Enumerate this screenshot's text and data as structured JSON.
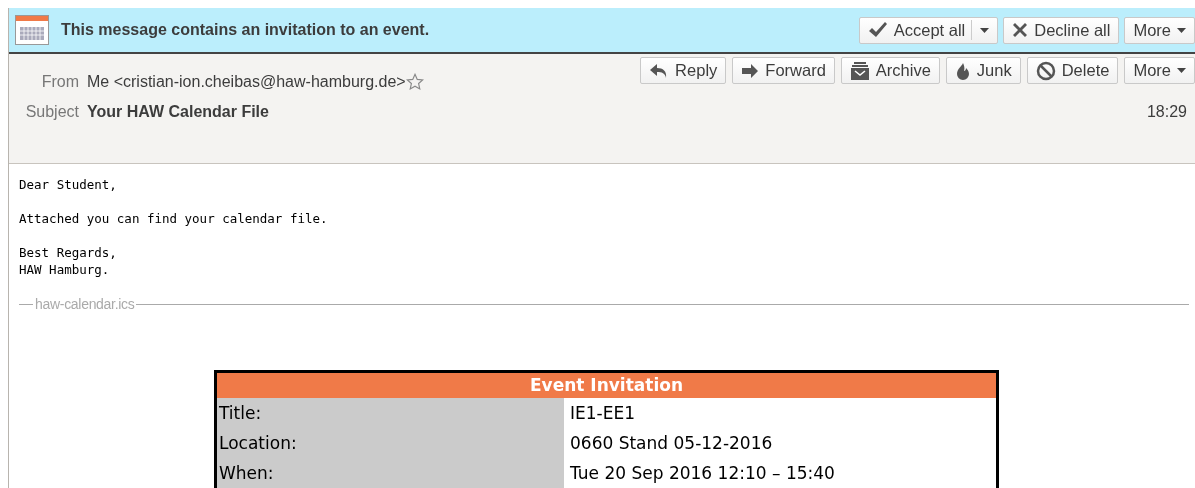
{
  "invitation_bar": {
    "message": "This message contains an invitation to an event.",
    "buttons": [
      {
        "label": "Accept all",
        "kind": "check",
        "dropdown": true
      },
      {
        "label": "Decline all",
        "kind": "cross",
        "dropdown": false
      },
      {
        "label": "More",
        "kind": "plain",
        "dropdown": true
      }
    ]
  },
  "header": {
    "from_label": "From",
    "from": "Me <cristian-ion.cheibas@haw-hamburg.de>",
    "subject_label": "Subject",
    "subject": "Your HAW Calendar File",
    "time": "18:29",
    "buttons": [
      {
        "label": "Reply",
        "kind": "reply",
        "dropdown": false
      },
      {
        "label": "Forward",
        "kind": "forward",
        "dropdown": false
      },
      {
        "label": "Archive",
        "kind": "archive",
        "dropdown": false
      },
      {
        "label": "Junk",
        "kind": "junk",
        "dropdown": false
      },
      {
        "label": "Delete",
        "kind": "delete",
        "dropdown": false
      },
      {
        "label": "More",
        "kind": "plain",
        "dropdown": true
      }
    ]
  },
  "body": {
    "paragraphs": [
      [
        "Dear Student,"
      ],
      [
        "Attached you can find your calendar file."
      ],
      [
        "Best Regards,",
        "HAW Hamburg."
      ]
    ]
  },
  "attachment": {
    "name": "haw-calendar.ics"
  },
  "event": {
    "title": "Event Invitation",
    "rows": [
      {
        "label": "Title:",
        "value": "IE1-EE1"
      },
      {
        "label": "Location:",
        "value": "0660 Stand 05-12-2016"
      },
      {
        "label": "When:",
        "value": "Tue 20 Sep 2016 12:10 – 15:40"
      }
    ]
  }
}
